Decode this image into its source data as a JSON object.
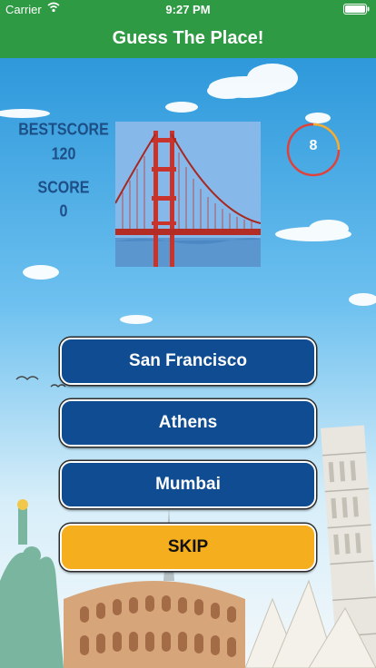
{
  "status_bar": {
    "carrier": "Carrier",
    "time": "9:27 PM"
  },
  "nav": {
    "title": "Guess The Place!"
  },
  "stats": {
    "best_score_label": "BESTSCORE",
    "best_score": "120",
    "score_label": "SCORE",
    "score": "0"
  },
  "timer": {
    "value": "8"
  },
  "answers": [
    {
      "label": "San Francisco"
    },
    {
      "label": "Athens"
    },
    {
      "label": "Mumbai"
    }
  ],
  "skip_label": "SKIP",
  "colors": {
    "nav_green": "#2f9a44",
    "button_blue": "#0f4c92",
    "skip_orange": "#f5ae1e",
    "score_text": "#1d4f86",
    "timer_ring": "#e0413a"
  }
}
